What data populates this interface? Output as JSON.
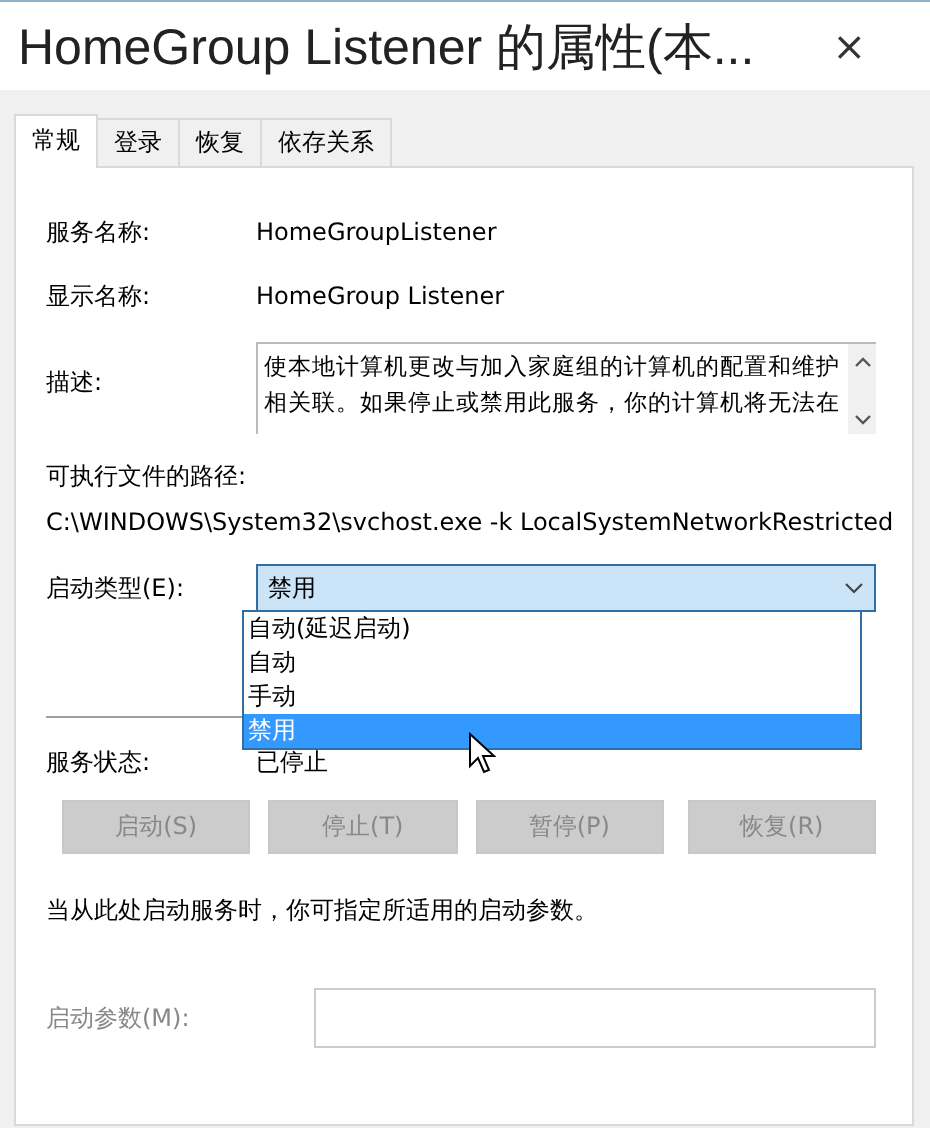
{
  "window": {
    "title": "HomeGroup Listener 的属性(本...",
    "close": "×"
  },
  "tabs": [
    {
      "label": "常规",
      "selected": true
    },
    {
      "label": "登录",
      "selected": false
    },
    {
      "label": "恢复",
      "selected": false
    },
    {
      "label": "依存关系",
      "selected": false
    }
  ],
  "fields": [
    {
      "label": "服务名称:",
      "value": "HomeGroupListener"
    },
    {
      "label": "显示名称:",
      "value": "HomeGroup Listener"
    }
  ],
  "description": {
    "label": "描述:",
    "text": "使本地计算机更改与加入家庭组的计算机的配置和维护相关联。如果停止或禁用此服务，你的计算机将无法在"
  },
  "path": {
    "label": "可执行文件的路径:",
    "value": "C:\\WINDOWS\\System32\\svchost.exe -k LocalSystemNetworkRestricted"
  },
  "startup_type": {
    "label": "启动类型(E):",
    "value": "禁用",
    "expanded": true,
    "options": [
      {
        "label": "自动(延迟启动)",
        "selected": false
      },
      {
        "label": "自动",
        "selected": false
      },
      {
        "label": "手动",
        "selected": false
      },
      {
        "label": "禁用",
        "selected": true
      }
    ]
  },
  "service_status": {
    "label": "服务状态:",
    "value": "已停止"
  },
  "buttons": [
    {
      "label": "启动(S)",
      "disabled": true
    },
    {
      "label": "停止(T)",
      "disabled": true
    },
    {
      "label": "暂停(P)",
      "disabled": true
    },
    {
      "label": "恢复(R)",
      "disabled": true
    }
  ],
  "hint": "当从此处启动服务时，你可指定所适用的启动参数。",
  "start_params": {
    "label": "启动参数(M):",
    "disabled": true
  }
}
